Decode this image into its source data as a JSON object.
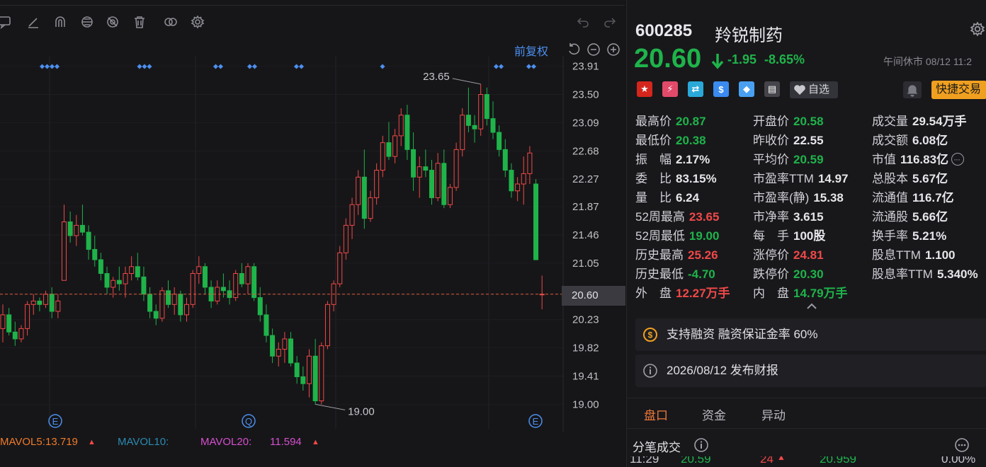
{
  "chart": {
    "adjust_label": "前复权",
    "current_price_label": "20.60",
    "high_label": "23.65",
    "low_label": "19.00",
    "price_ticks": [
      "23.91",
      "23.50",
      "23.09",
      "22.68",
      "22.27",
      "21.87",
      "21.46",
      "21.05",
      "20.60",
      "20.23",
      "19.82",
      "19.41",
      "19.00"
    ],
    "event_markers": [
      "E",
      "Q",
      "E"
    ],
    "colors": {
      "up": "#f04848",
      "down": "#1fb34a",
      "marker": "#4c8ff0",
      "price_line": "#e05a3a"
    }
  },
  "chart_data": {
    "type": "candlestick",
    "ylim": [
      18.85,
      24.05
    ],
    "candles": [
      [
        20.1,
        20.45,
        19.9,
        20.3
      ],
      [
        20.3,
        20.4,
        20.0,
        20.05
      ],
      [
        20.05,
        20.2,
        19.85,
        19.95
      ],
      [
        19.95,
        20.15,
        19.9,
        20.1
      ],
      [
        20.1,
        20.5,
        20.0,
        20.45
      ],
      [
        20.45,
        20.6,
        20.3,
        20.5
      ],
      [
        20.5,
        20.55,
        20.35,
        20.45
      ],
      [
        20.45,
        20.65,
        20.4,
        20.6
      ],
      [
        20.6,
        20.7,
        20.25,
        20.35
      ],
      [
        20.35,
        20.6,
        20.25,
        20.5
      ],
      [
        20.8,
        21.9,
        20.8,
        21.65
      ],
      [
        21.65,
        21.8,
        21.35,
        21.45
      ],
      [
        21.45,
        21.75,
        21.3,
        21.6
      ],
      [
        21.6,
        21.9,
        21.45,
        21.5
      ],
      [
        21.5,
        21.6,
        21.1,
        21.25
      ],
      [
        21.25,
        21.45,
        21.0,
        21.1
      ],
      [
        21.1,
        21.2,
        20.8,
        20.9
      ],
      [
        20.9,
        21.0,
        20.6,
        20.7
      ],
      [
        20.7,
        20.85,
        20.55,
        20.8
      ],
      [
        20.8,
        21.0,
        20.65,
        20.75
      ],
      [
        20.75,
        21.0,
        20.55,
        20.9
      ],
      [
        20.9,
        21.15,
        20.8,
        21.0
      ],
      [
        21.0,
        21.2,
        20.8,
        20.85
      ],
      [
        20.85,
        21.0,
        20.5,
        20.6
      ],
      [
        20.6,
        20.7,
        20.25,
        20.35
      ],
      [
        20.35,
        20.45,
        20.15,
        20.25
      ],
      [
        20.25,
        20.7,
        20.2,
        20.65
      ],
      [
        20.65,
        20.8,
        20.4,
        20.45
      ],
      [
        20.45,
        20.7,
        20.3,
        20.6
      ],
      [
        20.6,
        20.65,
        20.2,
        20.3
      ],
      [
        20.3,
        20.55,
        20.2,
        20.45
      ],
      [
        20.45,
        20.95,
        20.4,
        20.9
      ],
      [
        20.9,
        21.15,
        20.75,
        21.0
      ],
      [
        21.0,
        21.05,
        20.6,
        20.7
      ],
      [
        20.7,
        20.8,
        20.4,
        20.5
      ],
      [
        20.5,
        20.8,
        20.45,
        20.7
      ],
      [
        20.7,
        20.9,
        20.55,
        20.65
      ],
      [
        20.65,
        20.8,
        20.45,
        20.55
      ],
      [
        20.55,
        20.95,
        20.5,
        20.9
      ],
      [
        20.9,
        21.05,
        20.7,
        20.75
      ],
      [
        20.75,
        21.05,
        20.6,
        21.0
      ],
      [
        21.0,
        21.05,
        20.5,
        20.55
      ],
      [
        20.55,
        20.7,
        20.2,
        20.3
      ],
      [
        20.3,
        20.45,
        19.9,
        20.0
      ],
      [
        20.0,
        20.1,
        19.6,
        19.7
      ],
      [
        19.7,
        19.9,
        19.55,
        19.8
      ],
      [
        19.8,
        20.05,
        19.6,
        19.95
      ],
      [
        19.95,
        20.05,
        19.55,
        19.6
      ],
      [
        19.6,
        19.7,
        19.3,
        19.4
      ],
      [
        19.4,
        19.55,
        19.2,
        19.3
      ],
      [
        19.3,
        19.8,
        19.1,
        19.7
      ],
      [
        19.7,
        19.95,
        19.0,
        19.05
      ],
      [
        19.05,
        19.9,
        19.0,
        19.85
      ],
      [
        19.85,
        20.5,
        19.8,
        20.45
      ],
      [
        20.45,
        20.8,
        20.35,
        20.75
      ],
      [
        20.75,
        21.3,
        20.7,
        21.2
      ],
      [
        21.2,
        21.7,
        21.1,
        21.6
      ],
      [
        21.6,
        22.0,
        21.4,
        21.9
      ],
      [
        21.9,
        22.4,
        21.75,
        22.3
      ],
      [
        22.3,
        22.7,
        21.55,
        21.7
      ],
      [
        21.7,
        22.1,
        21.65,
        22.0
      ],
      [
        22.0,
        22.5,
        21.9,
        22.4
      ],
      [
        22.4,
        22.9,
        22.3,
        22.8
      ],
      [
        22.8,
        23.1,
        22.55,
        22.6
      ],
      [
        22.6,
        23.0,
        22.5,
        22.9
      ],
      [
        22.9,
        23.3,
        22.75,
        23.2
      ],
      [
        23.2,
        23.35,
        22.55,
        22.7
      ],
      [
        22.7,
        22.95,
        22.1,
        22.3
      ],
      [
        22.3,
        22.6,
        22.0,
        22.45
      ],
      [
        22.45,
        22.7,
        22.3,
        22.4
      ],
      [
        22.4,
        22.55,
        21.9,
        22.0
      ],
      [
        22.0,
        22.65,
        21.95,
        22.5
      ],
      [
        22.5,
        22.7,
        21.85,
        21.9
      ],
      [
        21.9,
        22.2,
        21.85,
        22.15
      ],
      [
        22.15,
        22.8,
        22.1,
        22.7
      ],
      [
        22.7,
        23.3,
        22.6,
        23.2
      ],
      [
        23.2,
        23.6,
        22.95,
        23.05
      ],
      [
        23.05,
        23.2,
        22.8,
        23.0
      ],
      [
        23.0,
        23.65,
        22.9,
        23.5
      ],
      [
        23.5,
        23.6,
        23.05,
        23.15
      ],
      [
        23.15,
        23.4,
        22.85,
        22.95
      ],
      [
        22.95,
        23.05,
        22.6,
        22.7
      ],
      [
        22.7,
        22.85,
        22.3,
        22.4
      ],
      [
        22.4,
        22.5,
        22.0,
        22.1
      ],
      [
        22.1,
        22.3,
        21.95,
        22.2
      ],
      [
        22.2,
        22.6,
        21.9,
        22.35
      ],
      [
        22.35,
        22.75,
        22.2,
        22.65
      ],
      [
        22.2,
        22.27,
        21.1,
        21.1
      ],
      [
        20.6,
        20.87,
        20.38,
        20.6
      ]
    ]
  },
  "volume_legend": {
    "mavol5_label": "MAVOL5:",
    "mavol5_value": "13.719",
    "mavol10_label": "MAVOL10:",
    "mavol10_value": "",
    "mavol20_label": "MAVOL20:",
    "mavol20_value": "11.594"
  },
  "quote": {
    "code": "600285",
    "name": "羚锐制药",
    "price": "20.60",
    "change": "-1.95",
    "change_pct": "-8.65%",
    "status": "午间休市 08/12 11:2",
    "fav_label": "自选",
    "trade_label": "快捷交易",
    "badges": [
      {
        "name": "china-flag-icon",
        "bg": "#d4261c",
        "glyph": "★"
      },
      {
        "name": "lightning-icon",
        "bg": "#e24a6a",
        "glyph": "⚡"
      },
      {
        "name": "shuffle-icon",
        "bg": "#2aa8d8",
        "glyph": "⇄"
      },
      {
        "name": "dollar-icon",
        "bg": "#3a8af0",
        "glyph": "$"
      },
      {
        "name": "tag-icon",
        "bg": "#4aa0f0",
        "glyph": "◆"
      },
      {
        "name": "note-icon",
        "bg": "#44444a",
        "glyph": "▤"
      }
    ],
    "stats": [
      [
        {
          "label": "最高价",
          "value": "20.87",
          "color": "green"
        },
        {
          "label": "开盘价",
          "value": "20.58",
          "color": "green"
        },
        {
          "label": "成交量",
          "value": "29.54万手",
          "color": "white"
        }
      ],
      [
        {
          "label": "最低价",
          "value": "20.38",
          "color": "green"
        },
        {
          "label": "昨收价",
          "value": "22.55",
          "color": "white"
        },
        {
          "label": "成交额",
          "value": "6.08亿",
          "color": "white"
        }
      ],
      [
        {
          "label": "振　幅",
          "value": "2.17%",
          "color": "white"
        },
        {
          "label": "平均价",
          "value": "20.59",
          "color": "green"
        },
        {
          "label": "市值",
          "value": "116.83亿",
          "color": "white"
        }
      ],
      [
        {
          "label": "委　比",
          "value": "83.15%",
          "color": "white"
        },
        {
          "label": "市盈率TTM",
          "value": "14.97",
          "color": "white"
        },
        {
          "label": "总股本",
          "value": "5.67亿",
          "color": "white"
        }
      ],
      [
        {
          "label": "量　比",
          "value": "6.24",
          "color": "white"
        },
        {
          "label": "市盈率(静)",
          "value": "15.38",
          "color": "white"
        },
        {
          "label": "流通值",
          "value": "116.7亿",
          "color": "white"
        }
      ],
      [
        {
          "label": "52周最高",
          "value": "23.65",
          "color": "red"
        },
        {
          "label": "市净率",
          "value": "3.615",
          "color": "white"
        },
        {
          "label": "流通股",
          "value": "5.66亿",
          "color": "white"
        }
      ],
      [
        {
          "label": "52周最低",
          "value": "19.00",
          "color": "green"
        },
        {
          "label": "每　手",
          "value": "100股",
          "color": "white"
        },
        {
          "label": "换手率",
          "value": "5.21%",
          "color": "white"
        }
      ],
      [
        {
          "label": "历史最高",
          "value": "25.26",
          "color": "red"
        },
        {
          "label": "涨停价",
          "value": "24.81",
          "color": "red"
        },
        {
          "label": "股息TTM",
          "value": "1.100",
          "color": "white"
        }
      ],
      [
        {
          "label": "历史最低",
          "value": "-4.70",
          "color": "green"
        },
        {
          "label": "跌停价",
          "value": "20.30",
          "color": "green"
        },
        {
          "label": "股息率TTM",
          "value": "5.340%",
          "color": "white"
        }
      ],
      [
        {
          "label": "外　盘",
          "value": "12.27万手",
          "color": "red"
        },
        {
          "label": "内　盘",
          "value": "14.79万手",
          "color": "green"
        },
        {
          "label": "",
          "value": "",
          "color": "white"
        }
      ]
    ],
    "margin_info": "支持融资 融资保证金率 60%",
    "report_info": "2026/08/12  发布财报",
    "tabs": [
      "盘口",
      "资金",
      "异动"
    ],
    "ticks_title": "分笔成交",
    "tick_row": [
      "11:29",
      "20.59",
      "24",
      "20.959",
      "0.00%"
    ]
  }
}
